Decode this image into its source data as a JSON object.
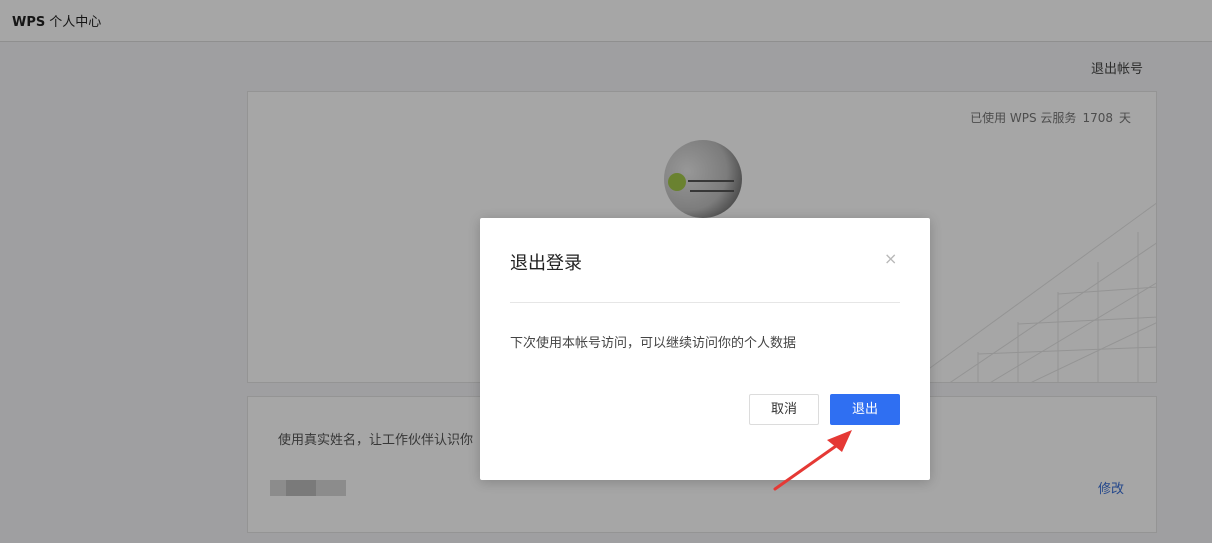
{
  "header": {
    "brand": "WPS",
    "title": "个人中心"
  },
  "account": {
    "logout_link": "退出帐号",
    "usage_prefix": "已使用 WPS 云服务",
    "usage_days": "1708",
    "usage_suffix": "天",
    "name_hint": "使用真实姓名，让工作伙伴认识你",
    "edit_label": "修改"
  },
  "dialog": {
    "title": "退出登录",
    "close_glyph": "×",
    "message": "下次使用本帐号访问，可以继续访问你的个人数据",
    "cancel_label": "取消",
    "confirm_label": "退出"
  },
  "colors": {
    "primary": "#2f6ff2",
    "annotation_arrow": "#e53935",
    "link": "#3a6fd6"
  }
}
